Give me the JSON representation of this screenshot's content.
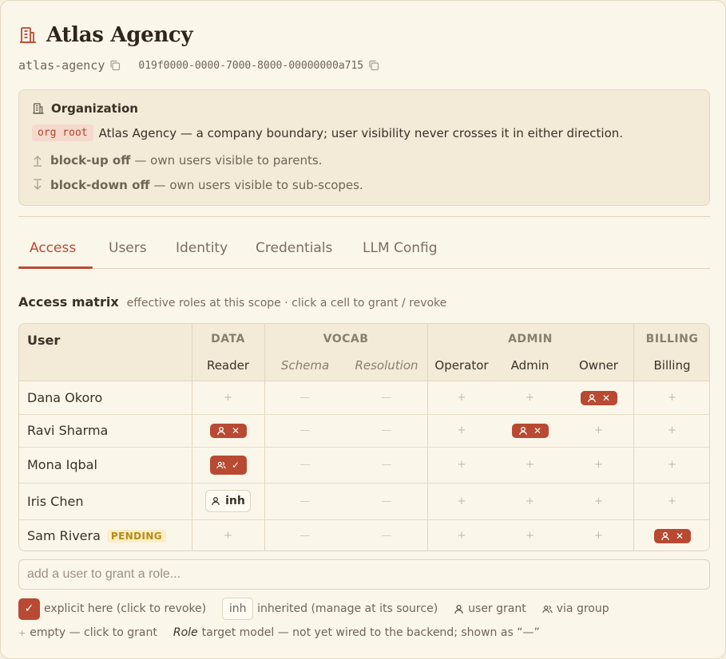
{
  "header": {
    "title": "Atlas Agency",
    "slug": "atlas-agency",
    "uuid": "019f0000-0000-7000-8000-00000000a715",
    "icon": "building-icon"
  },
  "organization": {
    "heading": "Organization",
    "root_tag": "org root",
    "description": "Atlas Agency — a company boundary; user visibility never crosses it in either direction.",
    "block_up": {
      "label": "block-up off",
      "text": "— own users visible to parents."
    },
    "block_down": {
      "label": "block-down off",
      "text": "— own users visible to sub-scopes."
    }
  },
  "tabs": [
    {
      "label": "Access",
      "active": true
    },
    {
      "label": "Users",
      "active": false
    },
    {
      "label": "Identity",
      "active": false
    },
    {
      "label": "Credentials",
      "active": false
    },
    {
      "label": "LLM Config",
      "active": false
    }
  ],
  "matrix": {
    "title": "Access matrix",
    "subtitle": "effective roles at this scope · click a cell to grant / revoke",
    "user_header": "User",
    "groups": [
      "DATA",
      "VOCAB",
      "ADMIN",
      "BILLING"
    ],
    "roles": [
      "Reader",
      "Schema",
      "Resolution",
      "Operator",
      "Admin",
      "Owner",
      "Billing"
    ],
    "rows": [
      {
        "user": "Dana Okoro",
        "badge": "",
        "cells": [
          "empty",
          "none",
          "none",
          "empty",
          "empty",
          "user-explicit",
          "empty"
        ]
      },
      {
        "user": "Ravi Sharma",
        "badge": "",
        "cells": [
          "user-explicit",
          "none",
          "none",
          "empty",
          "user-explicit",
          "empty",
          "empty"
        ]
      },
      {
        "user": "Mona Iqbal",
        "badge": "",
        "cells": [
          "group-explicit",
          "none",
          "none",
          "empty",
          "empty",
          "empty",
          "empty"
        ]
      },
      {
        "user": "Iris Chen",
        "badge": "",
        "cells": [
          "inherited",
          "none",
          "none",
          "empty",
          "empty",
          "empty",
          "empty"
        ]
      },
      {
        "user": "Sam Rivera",
        "badge": "PENDING",
        "cells": [
          "empty",
          "none",
          "none",
          "empty",
          "empty",
          "empty",
          "user-explicit"
        ]
      }
    ],
    "symbols": {
      "empty": "+",
      "none": "—",
      "revoke": "✕",
      "check": "✓",
      "inherited": "inh"
    }
  },
  "add_user": {
    "placeholder": "add a user to grant a role..."
  },
  "legend": {
    "explicit": "explicit here (click to revoke)",
    "inh_chip": "inh",
    "inherited": "inherited (manage at its source)",
    "user_grant": "user grant",
    "via_group": "via group",
    "plus": "+",
    "empty": "empty — click to grant",
    "role_word": "Role",
    "target": "target model — not yet wired to the backend; shown as “—”"
  },
  "colors": {
    "accent": "#b84a33",
    "background": "#fbf6ea",
    "pending": "#b88a16"
  }
}
